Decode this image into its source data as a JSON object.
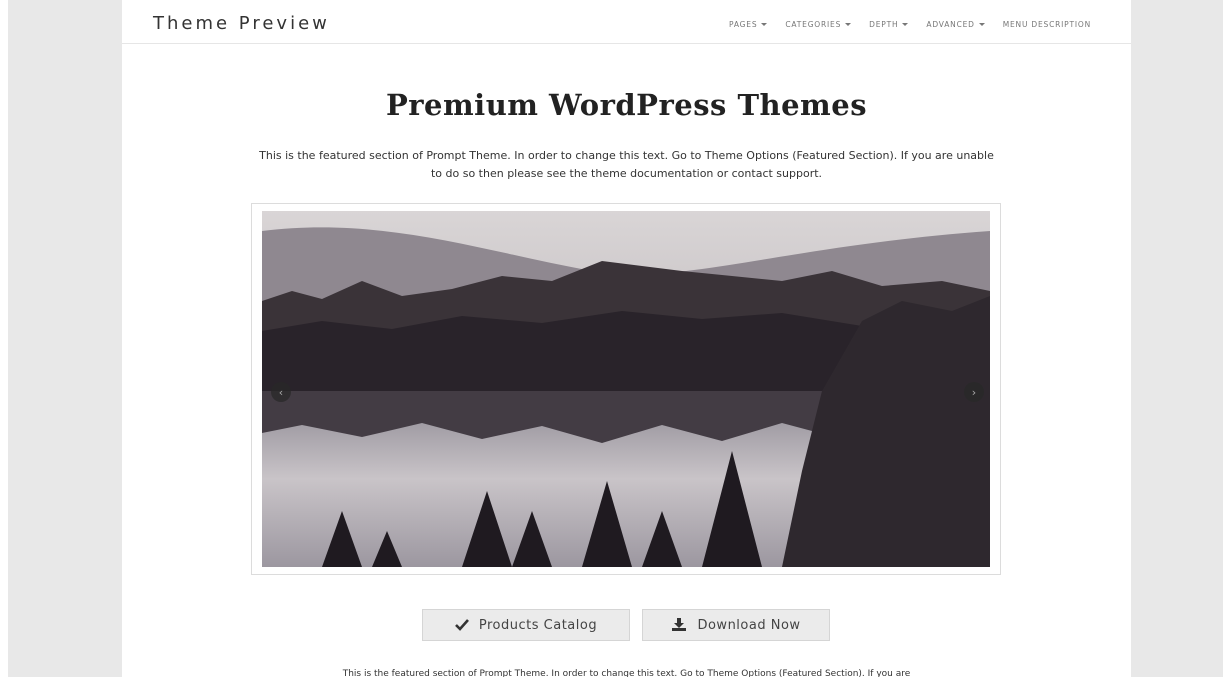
{
  "header": {
    "brand": "Theme Preview",
    "nav": [
      {
        "label": "PAGES",
        "dropdown": true
      },
      {
        "label": "CATEGORIES",
        "dropdown": true
      },
      {
        "label": "DEPTH",
        "dropdown": true
      },
      {
        "label": "ADVANCED",
        "dropdown": true
      },
      {
        "label": "MENU DESCRIPTION",
        "dropdown": false
      }
    ]
  },
  "featured": {
    "title": "Premium WordPress Themes",
    "description": "This is the featured section of Prompt Theme. In order to change this text. Go to Theme Options (Featured Section). If you are unable to do so then please see the theme documentation or contact support.",
    "slider": {
      "image": "forest-lake-landscape-photo",
      "prev_icon": "chevron-left-icon",
      "next_icon": "chevron-right-icon",
      "prev_glyph": "‹",
      "next_glyph": "›"
    },
    "buttons": {
      "catalog_icon": "check-icon",
      "catalog_label": "Products Catalog",
      "download_icon": "download-icon",
      "download_label": "Download Now"
    },
    "footer_text": "This is the featured section of Prompt Theme. In order to change this text. Go to Theme Options (Featured Section). If you are"
  },
  "colors": {
    "gutter": "#e8e8e8",
    "button_bg": "#ebebeb",
    "text": "#333333"
  }
}
